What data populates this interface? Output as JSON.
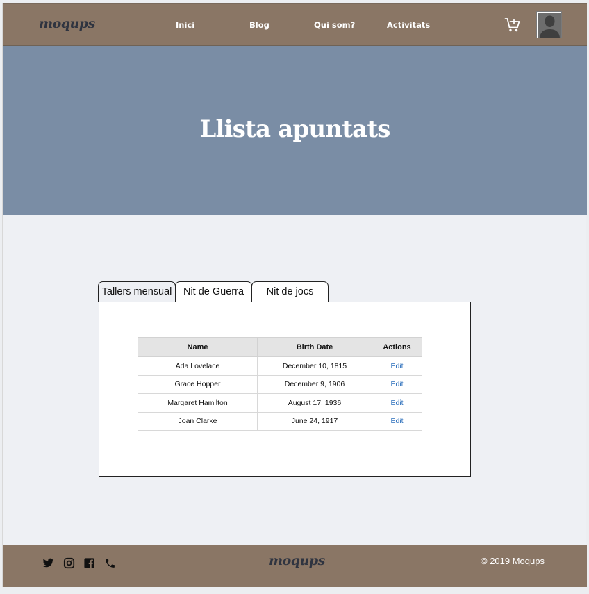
{
  "header": {
    "logo": "moqups",
    "nav": [
      "Inici",
      "Blog",
      "Qui som?",
      "Activitats"
    ]
  },
  "hero": {
    "title": "Llista apuntats"
  },
  "tabs": [
    "Tallers mensual",
    "Nit de Guerra",
    "Nit de jocs"
  ],
  "table": {
    "headers": [
      "Name",
      "Birth Date",
      "Actions"
    ],
    "rows": [
      {
        "name": "Ada Lovelace",
        "date": "December 10, 1815",
        "action": "Edit"
      },
      {
        "name": "Grace Hopper",
        "date": "December 9, 1906",
        "action": "Edit"
      },
      {
        "name": "Margaret Hamilton",
        "date": "August 17, 1936",
        "action": "Edit"
      },
      {
        "name": "Joan Clarke",
        "date": "June 24, 1917",
        "action": "Edit"
      }
    ]
  },
  "footer": {
    "logo": "moqups",
    "copyright": "© 2019  Moqups",
    "social_icons": [
      "twitter-icon",
      "instagram-icon",
      "facebook-icon",
      "phone-icon"
    ]
  },
  "colors": {
    "header_bg": "#8a7665",
    "hero_bg": "#7a8da5",
    "page_bg": "#eef0f4",
    "link": "#2a6ebb"
  }
}
